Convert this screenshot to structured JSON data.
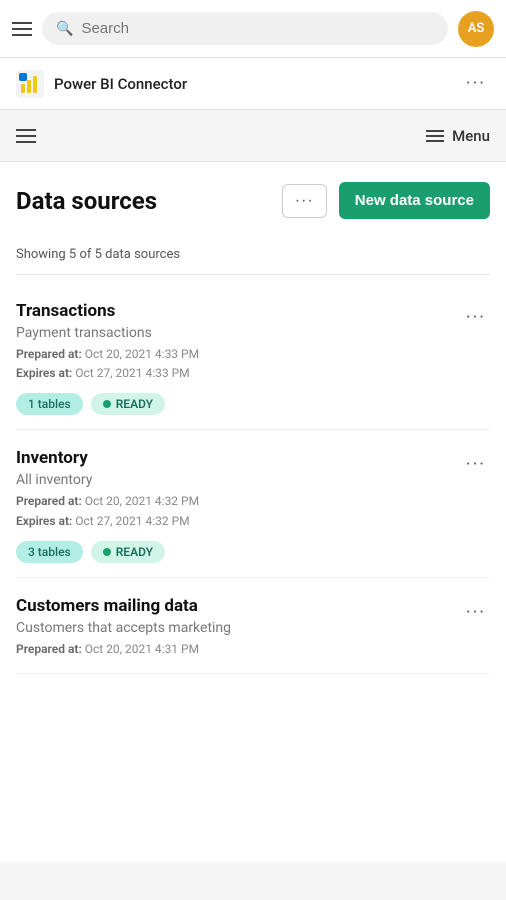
{
  "topbar": {
    "search_placeholder": "Search",
    "avatar_initials": "AS",
    "avatar_bg": "#e8a020"
  },
  "app_header": {
    "title": "Power BI Connector",
    "more_label": "···"
  },
  "secondary_nav": {
    "menu_label": "Menu"
  },
  "page": {
    "title": "Data sources",
    "ellipsis_label": "···",
    "new_source_label": "New data source",
    "summary": "Showing 5 of 5 data sources"
  },
  "datasources": [
    {
      "title": "Transactions",
      "subtitle": "Payment transactions",
      "prepared_label": "Prepared at:",
      "prepared_value": "Oct 20, 2021 4:33 PM",
      "expires_label": "Expires at:",
      "expires_value": "Oct 27, 2021 4:33 PM",
      "tables_tag": "1 tables",
      "status_tag": "READY"
    },
    {
      "title": "Inventory",
      "subtitle": "All inventory",
      "prepared_label": "Prepared at:",
      "prepared_value": "Oct 20, 2021 4:32 PM",
      "expires_label": "Expires at:",
      "expires_value": "Oct 27, 2021 4:32 PM",
      "tables_tag": "3 tables",
      "status_tag": "READY"
    },
    {
      "title": "Customers mailing data",
      "subtitle": "Customers that accepts marketing",
      "prepared_label": "Prepared at:",
      "prepared_value": "Oct 20, 2021 4:31 PM",
      "expires_label": "",
      "expires_value": "",
      "tables_tag": "",
      "status_tag": ""
    }
  ],
  "colors": {
    "accent": "#1b9e6e"
  }
}
